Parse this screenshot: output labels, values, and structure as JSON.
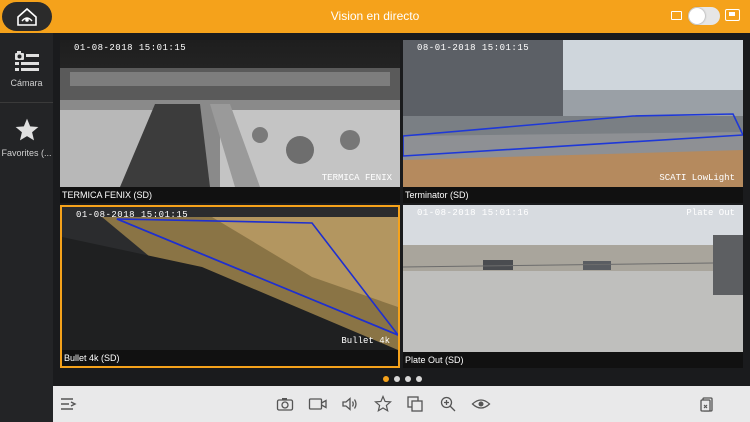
{
  "header": {
    "title": "Vision en directo",
    "accent_color": "#f5a21b",
    "home_icon": "home-eye-icon",
    "message_icon": "message-icon",
    "toggle_state": "off",
    "screen_icon": "screen-icon"
  },
  "sidebar": {
    "items": [
      {
        "label": "Cámara",
        "icon": "camera-list-icon"
      },
      {
        "label": "Favorites (...",
        "icon": "star-icon"
      }
    ]
  },
  "cameras": [
    {
      "name": "TERMICA FENIX (SD)",
      "timestamp": "01-08-2018 15:01:15",
      "overlay": "TERMICA FENIX"
    },
    {
      "name": "Terminator (SD)",
      "timestamp": "08-01-2018 15:01:15",
      "overlay": "SCATI LowLight"
    },
    {
      "name": "Bullet 4k (SD)",
      "timestamp": "01-08-2018 15:01:15",
      "overlay": "Bullet 4k",
      "selected": true
    },
    {
      "name": "Plate Out (SD)",
      "timestamp": "01-08-2018 15:01:16",
      "overlay": "Plate Out"
    }
  ],
  "pagination": {
    "pages": 4,
    "current": 1
  },
  "toolbar": {
    "icons": [
      "menu-arrow-icon",
      "snapshot-icon",
      "record-icon",
      "audio-icon",
      "favorite-icon",
      "copy-icon",
      "zoom-icon",
      "eye-icon",
      "delete-all-icon"
    ]
  }
}
